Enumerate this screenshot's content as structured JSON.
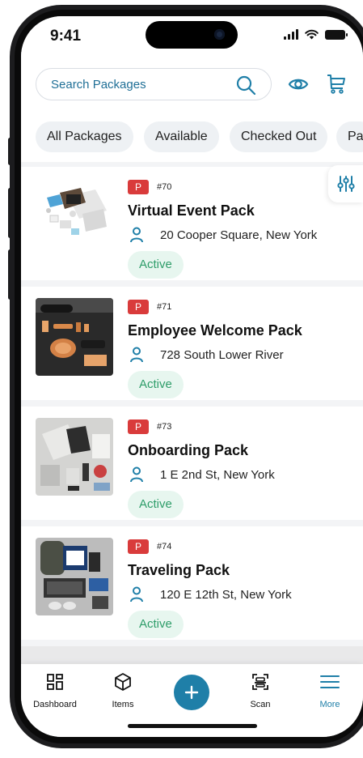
{
  "status_bar": {
    "time": "9:41"
  },
  "search": {
    "placeholder": "Search Packages"
  },
  "chips": [
    "All Packages",
    "Available",
    "Checked Out",
    "Pa"
  ],
  "packages": [
    {
      "badge": "P",
      "id": "#70",
      "name": "Virtual Event Pack",
      "address": "20 Cooper Square, New York",
      "status": "Active"
    },
    {
      "badge": "P",
      "id": "#71",
      "name": "Employee Welcome Pack",
      "address": "728 South Lower River",
      "status": "Active"
    },
    {
      "badge": "P",
      "id": "#73",
      "name": "Onboarding Pack",
      "address": "1 E 2nd St, New York",
      "status": "Active"
    },
    {
      "badge": "P",
      "id": "#74",
      "name": "Traveling Pack",
      "address": "120 E 12th St, New York",
      "status": "Active"
    }
  ],
  "nav": {
    "dashboard": "Dashboard",
    "items": "Items",
    "scan": "Scan",
    "more": "More"
  },
  "colors": {
    "accent": "#1f7fa8",
    "badge_red": "#d93b3b",
    "status_green": "#2e9d69",
    "status_bg": "#e7f6ef"
  }
}
